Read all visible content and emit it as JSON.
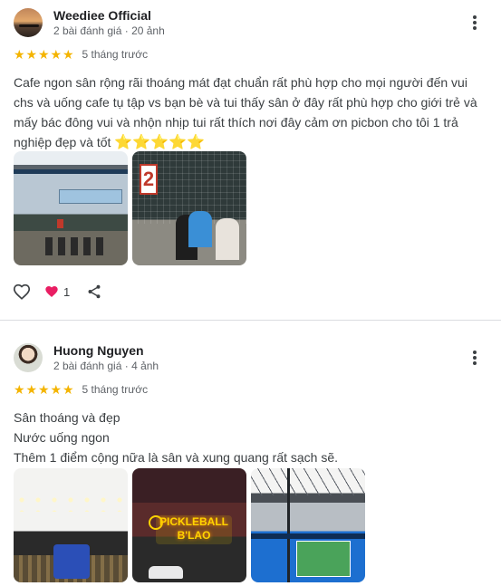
{
  "reviews": [
    {
      "author": "Weediee Official",
      "meta": "2 bài đánh giá · 20 ảnh",
      "stars": 5,
      "when": "5 tháng trước",
      "text": "Cafe ngon sân rộng rãi thoáng mát đạt chuẩn rất phù hợp cho mọi người đến vui chs và uống cafe tụ tập vs bạn bè và tui thấy sân ở đây rất phù hợp cho giới trẻ và mấy bác đông vui và nhộn nhịp tui rất thích nơi đây cảm ơn picbon cho tôi 1 trả nghiệp đẹp và tốt",
      "emoji": "⭐⭐⭐⭐⭐",
      "reaction_count": "1"
    },
    {
      "author": "Huong Nguyen",
      "meta": "2 bài đánh giá · 4 ảnh",
      "stars": 5,
      "when": "5 tháng trước",
      "lines": [
        "Sân thoáng và đẹp",
        "Nước uống ngon",
        "Thêm 1 điểm cộng nữa là sân và xung quang rất sạch sẽ."
      ],
      "neon_sign": "PICKLEBALL B'LAO"
    }
  ],
  "icons": {
    "more": "more-vert-icon",
    "like": "thumb-heart-outline-icon",
    "heart": "heart-icon",
    "share": "share-icon",
    "star": "star-icon"
  },
  "colors": {
    "star": "#f4b400",
    "heart": "#e91e63",
    "divider": "#dadce0",
    "meta": "#5f6368"
  }
}
